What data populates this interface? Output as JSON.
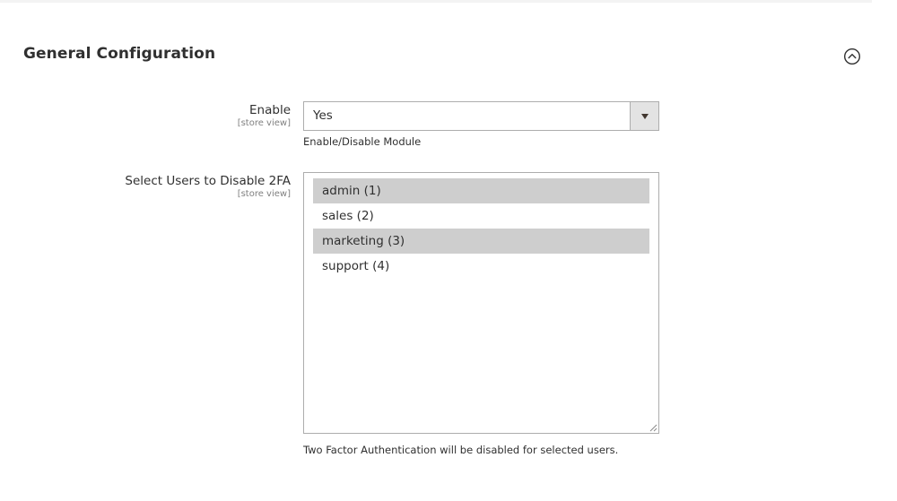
{
  "section": {
    "title": "General Configuration"
  },
  "fields": {
    "enable": {
      "label": "Enable",
      "scope": "[store view]",
      "value": "Yes",
      "note": "Enable/Disable Module"
    },
    "users": {
      "label": "Select Users to Disable 2FA",
      "scope": "[store view]",
      "options": [
        {
          "label": "admin (1)",
          "selected": true
        },
        {
          "label": "sales (2)",
          "selected": false
        },
        {
          "label": "marketing (3)",
          "selected": true
        },
        {
          "label": "support (4)",
          "selected": false
        }
      ],
      "note": "Two Factor Authentication will be disabled for selected users."
    }
  },
  "colors": {
    "selected_option": "#cecece",
    "border": "#adadad",
    "arrow_button": "#e3e3e3"
  },
  "icons": {
    "collapse": "chevron-up-circle-icon",
    "dropdown": "caret-down-icon",
    "resize": "resize-grip-icon"
  }
}
